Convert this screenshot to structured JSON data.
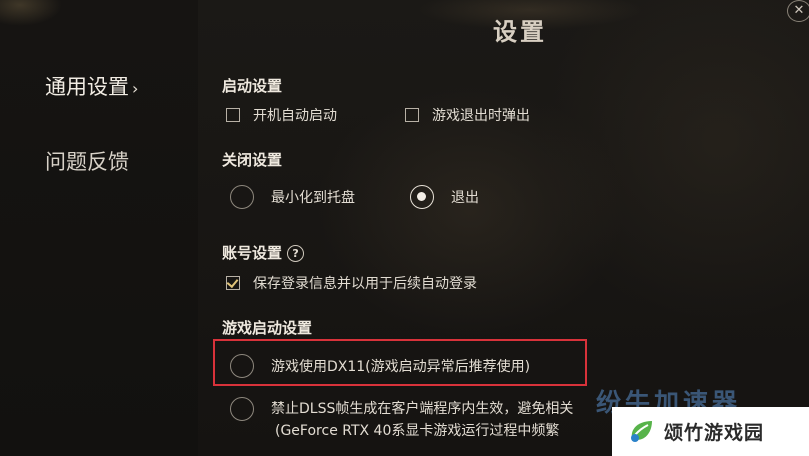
{
  "header": {
    "title": "设置",
    "close_glyph": "✕"
  },
  "nav": {
    "items": [
      {
        "label": "通用设置",
        "chevron": "›"
      },
      {
        "label": "问题反馈"
      }
    ]
  },
  "startup": {
    "heading": "启动设置",
    "options": [
      {
        "label": "开机自动启动",
        "checked": false
      },
      {
        "label": "游戏退出时弹出",
        "checked": false
      }
    ]
  },
  "close_settings": {
    "heading": "关闭设置",
    "options": [
      {
        "label": "最小化到托盘",
        "selected": false
      },
      {
        "label": "退出",
        "selected": true
      }
    ]
  },
  "account": {
    "heading": "账号设置",
    "help_glyph": "?",
    "options": [
      {
        "label": "保存登录信息并以用于后续自动登录",
        "checked": true
      }
    ]
  },
  "game_launch": {
    "heading": "游戏启动设置",
    "options": [
      {
        "label": "游戏使用DX11(游戏启动异常后推荐使用)",
        "selected": false
      },
      {
        "label": "禁止DLSS帧生成在客户端程序内生效，避免相关",
        "selected": false,
        "line2": "(GeForce RTX 40系显卡游戏运行过程中频繁"
      }
    ]
  },
  "watermark": {
    "text": "颂竹游戏园",
    "ghost": "纷牛加速器"
  },
  "colors": {
    "highlight": "#d8323a",
    "tick": "#e0c47a",
    "background": "#171513"
  }
}
